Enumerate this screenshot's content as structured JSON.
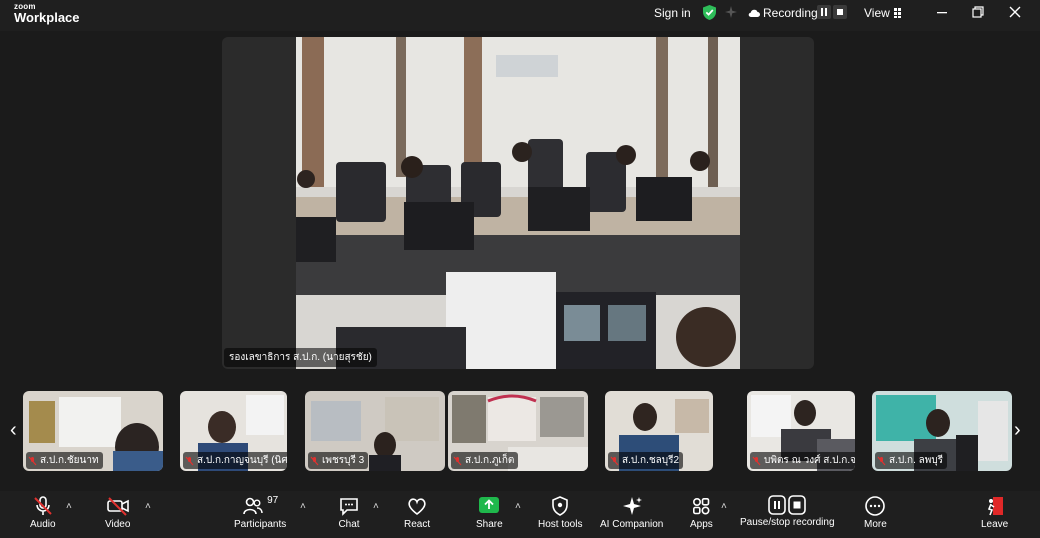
{
  "app": {
    "logo_small": "zoom",
    "logo_big": "Workplace"
  },
  "titlebar": {
    "sign_in": "Sign in",
    "recording_label": "Recording...",
    "view_label": "View",
    "icons": [
      "shield-check-icon",
      "sparkle-icon",
      "cloud-icon",
      "pause-icon",
      "stop-icon",
      "grid-icon",
      "minimize-icon",
      "restore-icon",
      "close-icon"
    ]
  },
  "main_video": {
    "name": "รองเลขาธิการ ส.ป.ก. (นายสุรชัย)"
  },
  "participants_strip": [
    {
      "name": "ส.ป.ก.ชัยนาท",
      "muted": true
    },
    {
      "name": "ส.ป.ก.กาญจนบุรี (นิศ...",
      "muted": true
    },
    {
      "name": "เพชรบุรี 3",
      "muted": true
    },
    {
      "name": "ส.ป.ก.ภูเก็ต",
      "muted": true
    },
    {
      "name": "ส.ป.ก.ชลบุรี2",
      "muted": true
    },
    {
      "name": "บพิตร ณ วงศ์ ส.ป.ก.จ...",
      "muted": true
    },
    {
      "name": "ส.ป.ก. ลพบุรี",
      "muted": true
    }
  ],
  "toolbar": {
    "audio": "Audio",
    "video": "Video",
    "participants": "Participants",
    "participants_count": "97",
    "chat": "Chat",
    "react": "React",
    "share": "Share",
    "host_tools": "Host tools",
    "ai_companion": "AI Companion",
    "apps": "Apps",
    "pause_stop": "Pause/stop recording",
    "more": "More",
    "leave": "Leave"
  },
  "colors": {
    "share_green": "#1fb84c",
    "leave_red": "#e02828",
    "shield_green": "#2ebd59",
    "muted_red": "#e0312f"
  }
}
